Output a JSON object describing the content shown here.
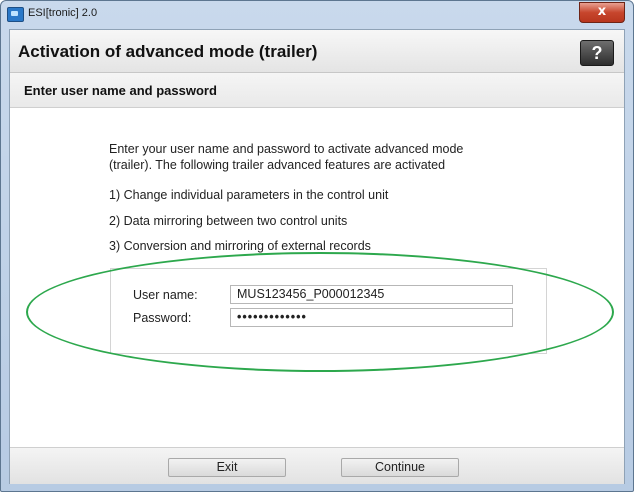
{
  "window": {
    "title": "ESI[tronic] 2.0",
    "close_glyph": "x"
  },
  "header": {
    "title": "Activation of advanced mode (trailer)",
    "help_label": "?"
  },
  "subheader": {
    "title": "Enter user name and password"
  },
  "content": {
    "intro": "Enter your user name and password to activate advanced mode (trailer). The following trailer advanced features are activated",
    "features": [
      "1) Change individual parameters in the control unit",
      "2) Data mirroring between two control units",
      "3) Conversion and mirroring of external records"
    ]
  },
  "credentials": {
    "username_label": "User name:",
    "username_value": "MUS123456_P000012345",
    "password_label": "Password:",
    "password_value": "•••••••••••••"
  },
  "footer": {
    "exit_label": "Exit",
    "continue_label": "Continue"
  },
  "colors": {
    "highlight": "#2da84d",
    "close_button": "#c7462d"
  },
  "icons": {
    "app": "app-icon",
    "close": "close-icon",
    "help": "help-icon"
  }
}
